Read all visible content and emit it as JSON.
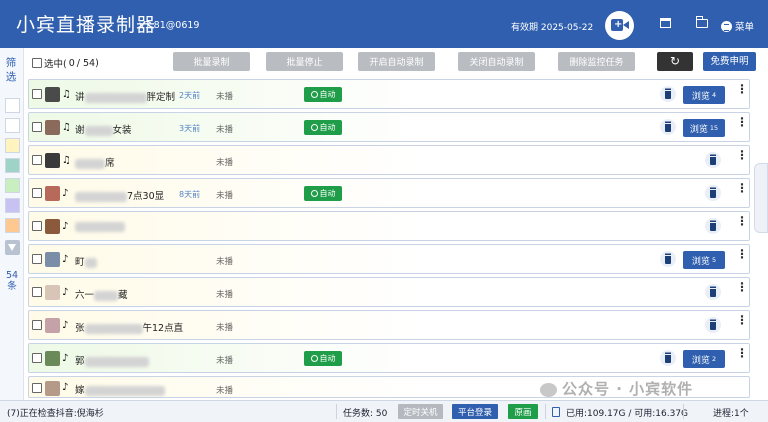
{
  "app": {
    "title": "小宾直播录制器",
    "version": "v1.81@0619",
    "expiry": "有效期 2025-05-22",
    "menu_label": "菜单"
  },
  "sidebar": {
    "filter_label": "筛选",
    "count_label": "54条",
    "swatch_colors": [
      "#ffffff",
      "#ffffff",
      "#fff3bf",
      "#9fd3c7",
      "#c9efc0",
      "#c8c2f2",
      "#ffc890"
    ]
  },
  "toolbar": {
    "select_label": "选中(",
    "selected_count": "0",
    "total_label": "/ 54)",
    "buttons": [
      "批量录制",
      "批量停止",
      "开启自动录制",
      "关闭自动录制",
      "删除监控任务"
    ],
    "refresh_icon": "↻",
    "free_label": "免费申明"
  },
  "rows": [
    {
      "platform": "♫",
      "name": "讲",
      "name2": "胖定制",
      "ago": "2天前",
      "status": "未播",
      "auto": "自动",
      "browse": "浏览",
      "browse_count": "4",
      "avatar": "#4a4a4a"
    },
    {
      "platform": "♫",
      "name": "谢",
      "name2": "女装",
      "ago": "3天前",
      "status": "未播",
      "auto": "自动",
      "browse": "浏览",
      "browse_count": "15",
      "avatar": "#8a6b5b"
    },
    {
      "platform": "♫",
      "name": "",
      "name2": "席",
      "ago": "",
      "status": "未播",
      "auto": "",
      "browse": "",
      "browse_count": "",
      "avatar": "#3a3a3a"
    },
    {
      "platform": "♪",
      "name": "",
      "name2": "7点30显",
      "ago": "8天前",
      "status": "未播",
      "auto": "自动",
      "browse": "",
      "browse_count": "",
      "avatar": "#b86a5a"
    },
    {
      "platform": "♪",
      "name": "",
      "name2": "",
      "ago": "",
      "status": "",
      "auto": "",
      "browse": "",
      "browse_count": "",
      "avatar": "#8b5a3c"
    },
    {
      "platform": "♪",
      "name": "町",
      "name2": "",
      "ago": "",
      "status": "未播",
      "auto": "",
      "browse": "浏览",
      "browse_count": "5",
      "avatar": "#7a8ea8"
    },
    {
      "platform": "♪",
      "name": "六一",
      "name2": "藏",
      "ago": "",
      "status": "未播",
      "auto": "",
      "browse": "",
      "browse_count": "",
      "avatar": "#d9c4b8"
    },
    {
      "platform": "♪",
      "name": "张",
      "name2": "午12点直",
      "ago": "",
      "status": "未播",
      "auto": "",
      "browse": "",
      "browse_count": "",
      "avatar": "#c5a1a8"
    },
    {
      "platform": "♪",
      "name": "郭",
      "name2": "",
      "ago": "",
      "status": "未播",
      "auto": "自动",
      "browse": "浏览",
      "browse_count": "2",
      "avatar": "#6a8a5a"
    },
    {
      "platform": "♪",
      "name": "嫁",
      "name2": "",
      "ago": "",
      "status": "未播",
      "auto": "",
      "browse": "",
      "browse_count": "",
      "avatar": "#b59a8a"
    }
  ],
  "watermark": "公众号 · 小宾软件",
  "statusbar": {
    "left_text": "(7)正在检查抖音:倪海杉",
    "task_label": "任务数:",
    "task_count": "50",
    "shutdown": "定时关机",
    "login": "平台登录",
    "original": "原画",
    "disk": "已用:109.17G / 可用:16.37G",
    "progress": "进程:1个"
  }
}
